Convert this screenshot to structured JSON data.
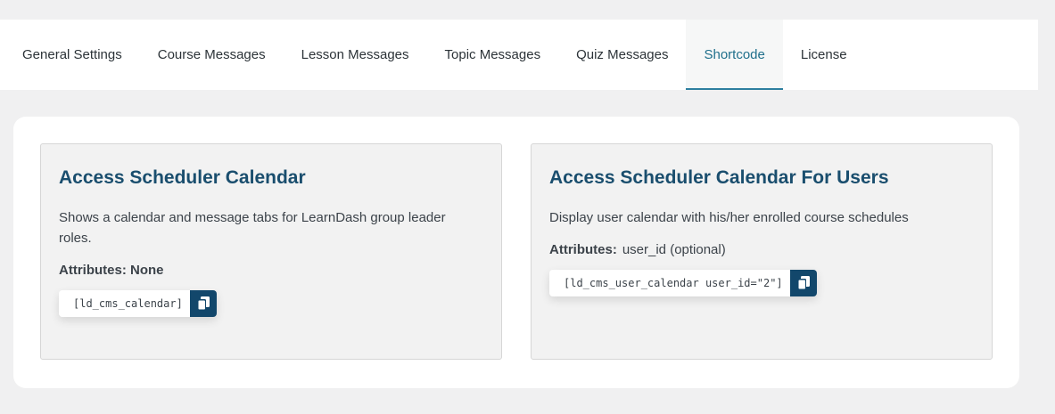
{
  "tabs": [
    {
      "label": "General Settings",
      "active": false
    },
    {
      "label": "Course Messages",
      "active": false
    },
    {
      "label": "Lesson Messages",
      "active": false
    },
    {
      "label": "Topic Messages",
      "active": false
    },
    {
      "label": "Quiz Messages",
      "active": false
    },
    {
      "label": "Shortcode",
      "active": true
    },
    {
      "label": "License",
      "active": false
    }
  ],
  "cards": [
    {
      "title": "Access Scheduler Calendar",
      "description": "Shows a calendar and message tabs for LearnDash group leader roles.",
      "attributes_label": "Attributes: None",
      "attributes_value": "",
      "shortcode": "[ld_cms_calendar]",
      "copy_icon": "copy-icon"
    },
    {
      "title": "Access Scheduler Calendar For Users",
      "description": "Display user calendar with his/her enrolled course schedules",
      "attributes_label": "Attributes:",
      "attributes_value": "user_id (optional)",
      "shortcode": "[ld_cms_user_calendar user_id=\"2\"]",
      "copy_icon": "copy-icon"
    }
  ],
  "colors": {
    "accent": "#1f6f8b",
    "title": "#1a4e6e",
    "copy_button": "#12476b",
    "page_bg": "#f0f0f1"
  }
}
